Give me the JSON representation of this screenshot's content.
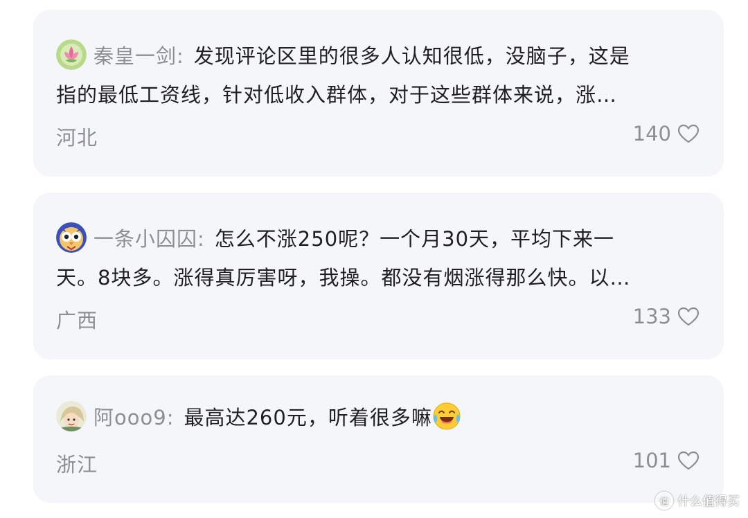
{
  "comments": [
    {
      "username": "秦皇一剑",
      "separator": ":",
      "line1": "发现评论区里的很多人认知很低，没脑子，这是",
      "line2": "指的最低工资线，针对低收入群体，对于这些群体来说，涨…",
      "location": "河北",
      "likes": "140",
      "avatar_icon": "lotus-flower-avatar"
    },
    {
      "username": "一条小囚囚",
      "separator": ":",
      "line1": "怎么不涨250呢？一个月30天，平均下来一",
      "line2": "天。8块多。涨得真厉害呀，我操。都没有烟涨得那么快。以…",
      "location": "广西",
      "likes": "133",
      "avatar_icon": "owl-avatar"
    },
    {
      "username": "阿ooo9",
      "separator": ":",
      "line1": "最高达260元，听着很多嘛",
      "location": "浙江",
      "likes": "101",
      "avatar_icon": "anime-character-avatar",
      "emoji": "laughing-crying-emoji"
    }
  ],
  "watermark": {
    "text": "什么值得买",
    "logo": "值"
  },
  "colors": {
    "card_bg": "#f5f6f9",
    "text_primary": "#1f1f1f",
    "text_secondary": "#8d8d94"
  }
}
